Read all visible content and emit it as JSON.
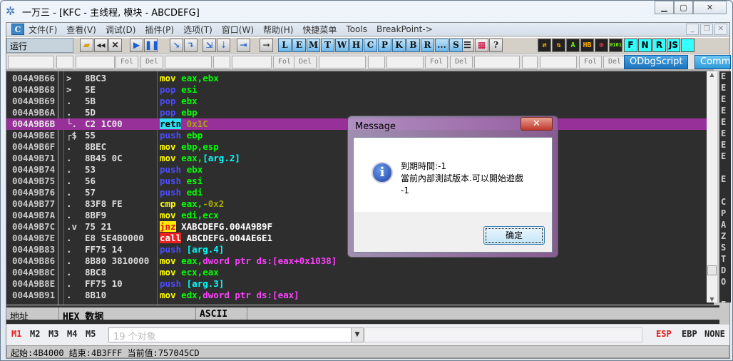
{
  "window": {
    "title": "一万三 - [KFC -  主线程, 模块 - ABCDEFG]"
  },
  "menu": [
    "文件(F)",
    "查看(V)",
    "调试(D)",
    "插件(P)",
    "选项(T)",
    "窗口(W)",
    "帮助(H)",
    "快捷菜单",
    "Tools",
    "BreakPoint->"
  ],
  "toolbar": {
    "status": "运行",
    "letters": [
      "L",
      "E",
      "M",
      "T",
      "W",
      "H",
      "C",
      "P",
      "K",
      "B",
      "R",
      "...",
      "S"
    ],
    "plugins": [
      "F",
      "N",
      "R",
      "JS",
      ""
    ]
  },
  "row2": {
    "fol": "Fol",
    "del": "Del",
    "odbgscript": "ODbgScript",
    "comm": "Comm"
  },
  "colors": {
    "mnemonic_mov": "#ffff00",
    "mnemonic_stack": "#4b4bff",
    "register": "#00ff00",
    "arg": "#00ffff",
    "const": "#a8a800",
    "mem": "#ff40ff",
    "label": "#ffffff",
    "selection": "#98309a"
  },
  "disasm": [
    {
      "addr": "004A9B66",
      "mark": ">",
      "hex": "8BC3",
      "ins": [
        [
          "mov ",
          "mov"
        ],
        [
          "eax,ebx",
          "register"
        ]
      ]
    },
    {
      "addr": "004A9B68",
      "mark": ">",
      "hex": "5E",
      "ins": [
        [
          "pop ",
          "stack"
        ],
        [
          "esi",
          "register"
        ]
      ]
    },
    {
      "addr": "004A9B69",
      "mark": ".",
      "hex": "5B",
      "ins": [
        [
          "pop ",
          "stack"
        ],
        [
          "ebx",
          "register"
        ]
      ]
    },
    {
      "addr": "004A9B6A",
      "mark": ".",
      "hex": "5D",
      "ins": [
        [
          "pop ",
          "stack"
        ],
        [
          "ebp",
          "register"
        ]
      ]
    },
    {
      "addr": "004A9B6B",
      "mark": "└.",
      "hex": "C2 1C00",
      "ins": [
        [
          "retn",
          "retn"
        ],
        [
          " 0x1C",
          "const"
        ]
      ],
      "selected": true
    },
    {
      "addr": "004A9B6E",
      "mark": "┌$",
      "hex": "55",
      "ins": [
        [
          "push ",
          "stack"
        ],
        [
          "ebp",
          "register"
        ]
      ]
    },
    {
      "addr": "004A9B6F",
      "mark": ".",
      "hex": "8BEC",
      "ins": [
        [
          "mov ",
          "mov"
        ],
        [
          "ebp,esp",
          "register"
        ]
      ]
    },
    {
      "addr": "004A9B71",
      "mark": ".",
      "hex": "8B45 0C",
      "ins": [
        [
          "mov ",
          "mov"
        ],
        [
          "eax,",
          "register"
        ],
        [
          "[arg.2]",
          "arg"
        ]
      ]
    },
    {
      "addr": "004A9B74",
      "mark": ".",
      "hex": "53",
      "ins": [
        [
          "push ",
          "stack"
        ],
        [
          "ebx",
          "register"
        ]
      ]
    },
    {
      "addr": "004A9B75",
      "mark": ".",
      "hex": "56",
      "ins": [
        [
          "push ",
          "stack"
        ],
        [
          "esi",
          "register"
        ]
      ]
    },
    {
      "addr": "004A9B76",
      "mark": ".",
      "hex": "57",
      "ins": [
        [
          "push ",
          "stack"
        ],
        [
          "edi",
          "register"
        ]
      ]
    },
    {
      "addr": "004A9B77",
      "mark": ".",
      "hex": "83F8 FE",
      "ins": [
        [
          "cmp ",
          "mov"
        ],
        [
          "eax,",
          "register"
        ],
        [
          "-0x2",
          "const"
        ]
      ]
    },
    {
      "addr": "004A9B7A",
      "mark": ".",
      "hex": "8BF9",
      "ins": [
        [
          "mov ",
          "mov"
        ],
        [
          "edi,ecx",
          "register"
        ]
      ]
    },
    {
      "addr": "004A9B7C",
      "mark": ".v",
      "hex": "75 21",
      "ins": [
        [
          "jnz",
          "jnz"
        ],
        [
          " XABCDEFG.004A9B9F",
          "label"
        ]
      ]
    },
    {
      "addr": "004A9B7E",
      "mark": ".",
      "hex": "E8 5E4B0000",
      "ins": [
        [
          "call",
          "call"
        ],
        [
          " ABCDEFG.004AE6E1",
          "label"
        ]
      ]
    },
    {
      "addr": "004A9B83",
      "mark": ".",
      "hex": "FF75 14",
      "ins": [
        [
          "push ",
          "stack"
        ],
        [
          "[arg.4]",
          "arg"
        ]
      ]
    },
    {
      "addr": "004A9B86",
      "mark": ".",
      "hex": "8B80 3810000",
      "ins": [
        [
          "mov ",
          "mov"
        ],
        [
          "eax,",
          "register"
        ],
        [
          "dword ptr ds:[eax+0x1038]",
          "mem"
        ]
      ]
    },
    {
      "addr": "004A9B8C",
      "mark": ".",
      "hex": "8BC8",
      "ins": [
        [
          "mov ",
          "mov"
        ],
        [
          "ecx,eax",
          "register"
        ]
      ]
    },
    {
      "addr": "004A9B8E",
      "mark": ".",
      "hex": "FF75 10",
      "ins": [
        [
          "push ",
          "stack"
        ],
        [
          "[arg.3]",
          "arg"
        ]
      ]
    },
    {
      "addr": "004A9B91",
      "mark": ".",
      "hex": "8B10",
      "ins": [
        [
          "mov ",
          "mov"
        ],
        [
          "edx,",
          "register"
        ],
        [
          "dword ptr ds:[eax]",
          "mem"
        ]
      ]
    }
  ],
  "registers": [
    "E",
    "E",
    "E",
    "E",
    "E",
    "E",
    "E",
    "E",
    "",
    "E",
    "",
    "C",
    "P",
    "A",
    "Z",
    "S",
    "T",
    "D",
    "O",
    "",
    "E"
  ],
  "dump": {
    "addr_header": "地址",
    "hex_header": "HEX 数据",
    "ascii_header": "ASCII"
  },
  "marks": {
    "m1": "M1",
    "m2": "M2",
    "m3": "M3",
    "m4": "M4",
    "m5": "M5",
    "combo_placeholder": "19 个对象",
    "esp": "ESP",
    "ebp": "EBP",
    "none": "NONE"
  },
  "status": "起始:4B4000 结束:4B3FFF 当前值:757045CD",
  "dialog": {
    "title": "Message",
    "line1": "到期時間:-1",
    "line2": "當前內部測試版本.可以開始遊戲",
    "line3": "-1",
    "ok": "确定"
  }
}
